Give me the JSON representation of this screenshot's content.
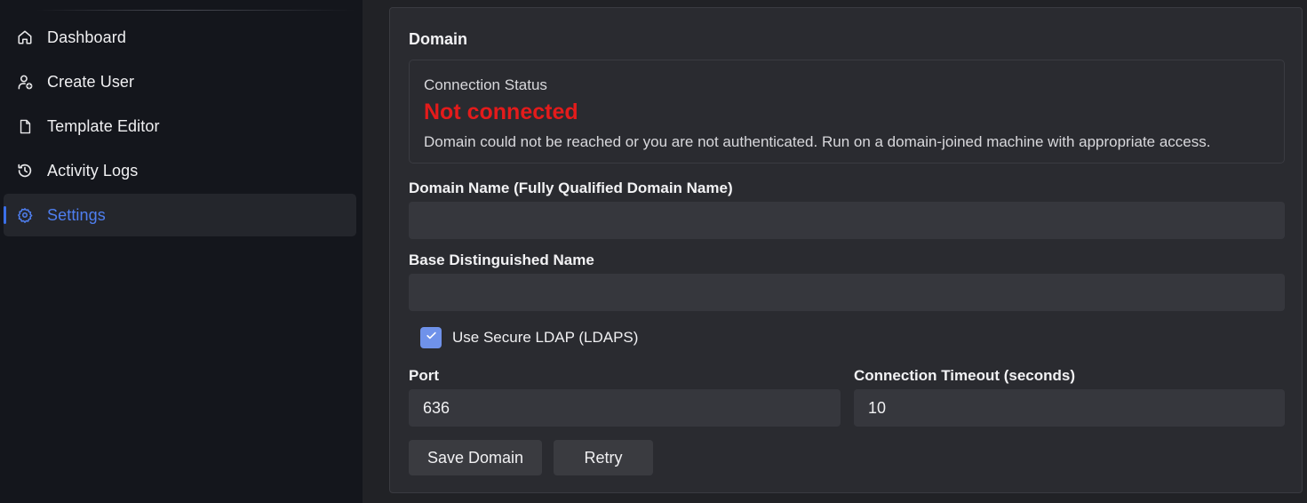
{
  "sidebar": {
    "items": [
      {
        "label": "Dashboard",
        "icon": "home-icon"
      },
      {
        "label": "Create User",
        "icon": "user-add-icon"
      },
      {
        "label": "Template Editor",
        "icon": "file-icon"
      },
      {
        "label": "Activity Logs",
        "icon": "history-icon"
      },
      {
        "label": "Settings",
        "icon": "gear-icon",
        "active": true
      }
    ]
  },
  "domain_card": {
    "title": "Domain",
    "status": {
      "caption": "Connection Status",
      "value": "Not connected",
      "description": "Domain could not be reached or you are not authenticated. Run on a domain-joined machine with appropriate access."
    },
    "domain_name": {
      "label": "Domain Name (Fully Qualified Domain Name)",
      "value": ""
    },
    "base_dn": {
      "label": "Base Distinguished Name",
      "value": ""
    },
    "use_ldaps": {
      "label": "Use Secure LDAP (LDAPS)",
      "checked": true
    },
    "port": {
      "label": "Port",
      "value": "636"
    },
    "timeout": {
      "label": "Connection Timeout (seconds)",
      "value": "10"
    },
    "save_button": "Save Domain",
    "retry_button": "Retry"
  },
  "colors": {
    "accent": "#4f7ff0",
    "error": "#e41b1b",
    "sidebar_bg": "#14161c",
    "card_bg": "#2a2b30"
  }
}
